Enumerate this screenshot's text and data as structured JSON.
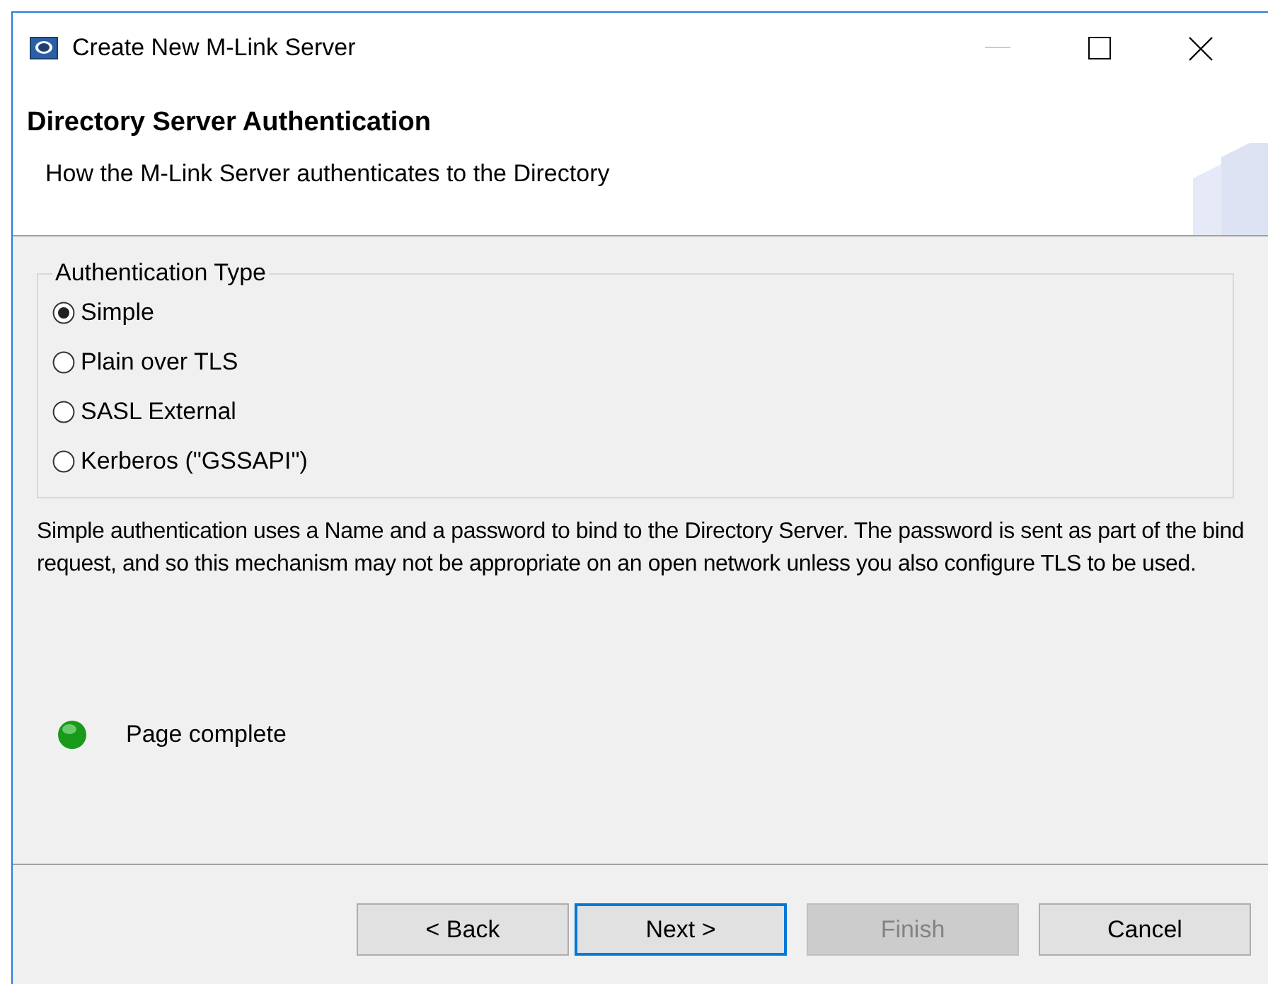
{
  "window": {
    "title": "Create New M-Link Server",
    "minimize_disabled": true
  },
  "header": {
    "title": "Directory Server Authentication",
    "subtitle": "How the M-Link Server authenticates to the Directory"
  },
  "auth_group": {
    "legend": "Authentication Type",
    "options": [
      {
        "label": "Simple",
        "selected": true
      },
      {
        "label": "Plain over TLS",
        "selected": false
      },
      {
        "label": "SASL External",
        "selected": false
      },
      {
        "label": "Kerberos (\"GSSAPI\")",
        "selected": false
      }
    ]
  },
  "description": "Simple authentication uses a Name and a password to bind to the Directory Server. The password is sent as part of the bind request, and so this mechanism may not be appropriate on an open network unless you also configure TLS to be used.",
  "status": {
    "text": "Page complete",
    "color": "#1a9a1a"
  },
  "buttons": [
    {
      "label": "< Back",
      "disabled": false,
      "default": false
    },
    {
      "label": "Next >",
      "disabled": false,
      "default": true
    },
    {
      "label": "Finish",
      "disabled": true,
      "default": false
    },
    {
      "label": "Cancel",
      "disabled": false,
      "default": false
    }
  ]
}
